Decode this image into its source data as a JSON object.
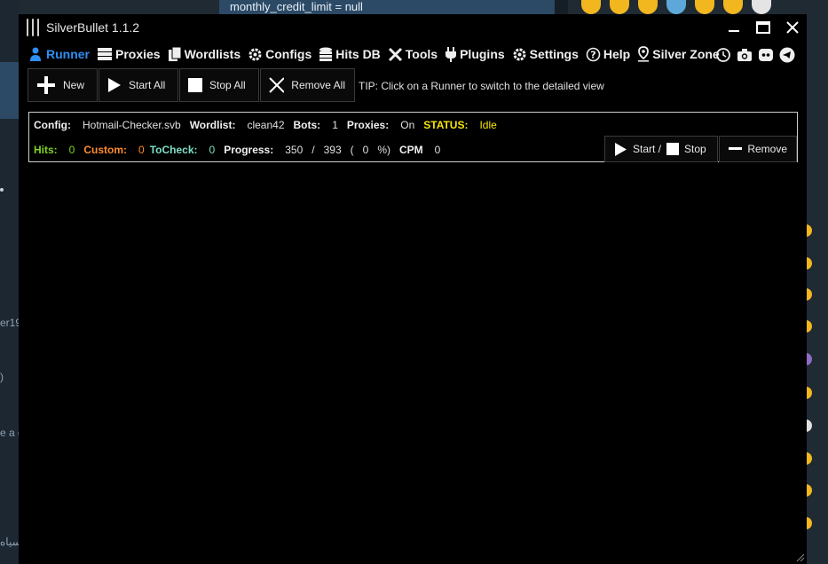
{
  "background": {
    "top_text": "monthly_credit_limit = null",
    "left_fragments": [
      "er19",
      ")",
      "e a g",
      "سياه"
    ]
  },
  "window": {
    "title": "SilverBullet 1.1.2",
    "accent_color": "#2f8ff5"
  },
  "menu": [
    {
      "label": "Runner",
      "icon": "runner-icon"
    },
    {
      "label": "Proxies",
      "icon": "server-icon"
    },
    {
      "label": "Wordlists",
      "icon": "files-icon"
    },
    {
      "label": "Configs",
      "icon": "gear-icon"
    },
    {
      "label": "Hits DB",
      "icon": "database-icon"
    },
    {
      "label": "Tools",
      "icon": "tools-icon"
    },
    {
      "label": "Plugins",
      "icon": "plug-icon"
    },
    {
      "label": "Settings",
      "icon": "gear-icon"
    },
    {
      "label": "Help",
      "icon": "question-icon"
    },
    {
      "label": "Silver Zone",
      "icon": "map-pin-icon"
    }
  ],
  "menu_icons": [
    "history-icon",
    "camera-icon",
    "discord-icon",
    "telegram-icon"
  ],
  "toolbar": {
    "new_label": "New",
    "start_all_label": "Start All",
    "stop_all_label": "Stop All",
    "remove_all_label": "Remove All",
    "tip": "TIP: Click on a Runner to switch to the detailed view"
  },
  "runner": {
    "config_label": "Config:",
    "config_value": "Hotmail-Checker.svb",
    "wordlist_label": "Wordlist:",
    "wordlist_value": "clean42",
    "bots_label": "Bots:",
    "bots_value": "1",
    "proxies_label": "Proxies:",
    "proxies_value": "On",
    "status_label": "STATUS:",
    "status_value": "Idle",
    "hits_label": "Hits:",
    "hits_value": "0",
    "custom_label": "Custom:",
    "custom_value": "0",
    "tocheck_label": "ToCheck:",
    "tocheck_value": "0",
    "progress_label": "Progress:",
    "progress_done": "350",
    "progress_sep": "/",
    "progress_total": "393",
    "progress_open": "(",
    "progress_percent": "0",
    "progress_close": "%)",
    "cpm_label": "CPM",
    "cpm_value": "0",
    "start_label": "Start /",
    "stop_label": "Stop",
    "remove_label": "Remove",
    "colors": {
      "hits": "#7ed321",
      "custom": "#ff8c2e",
      "tocheck": "#7fe0c8",
      "status": "#f5e50a"
    }
  }
}
